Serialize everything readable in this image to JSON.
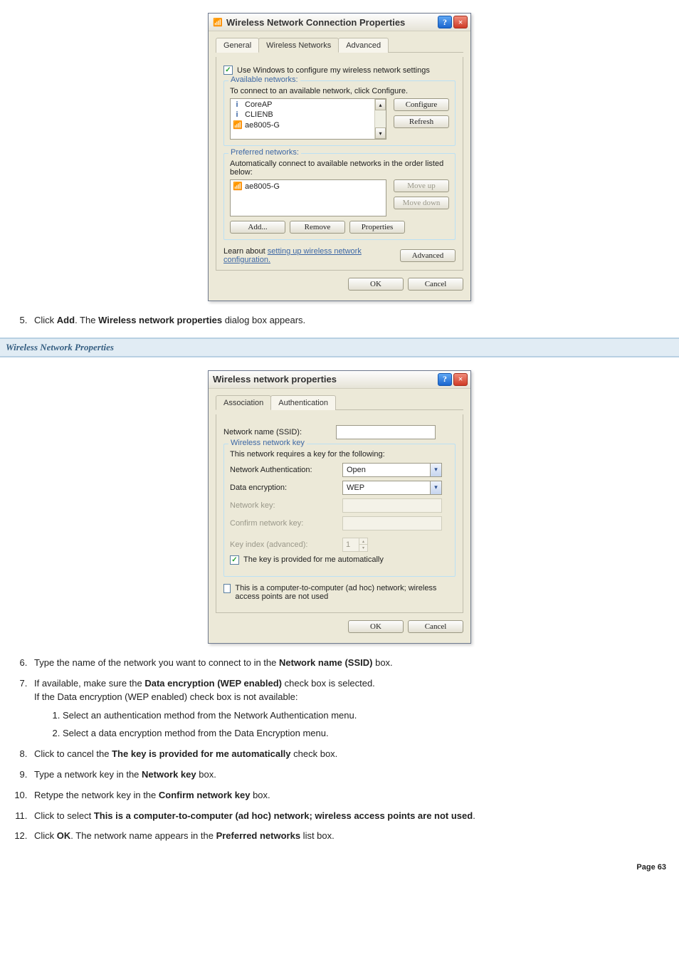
{
  "dialog1": {
    "title": "Wireless Network Connection Properties",
    "tabs": [
      "General",
      "Wireless Networks",
      "Advanced"
    ],
    "use_windows": "Use Windows to configure my wireless network settings",
    "available": {
      "legend": "Available networks:",
      "hint": "To connect to an available network, click Configure.",
      "items": [
        {
          "icon": "i",
          "name": "CoreAP"
        },
        {
          "icon": "i",
          "name": "CLIENB"
        },
        {
          "icon": "q",
          "name": "ae8005-G"
        }
      ],
      "configure": "Configure",
      "refresh": "Refresh"
    },
    "preferred": {
      "legend": "Preferred networks:",
      "hint": "Automatically connect to available networks in the order listed below:",
      "items": [
        {
          "icon": "q",
          "name": "ae8005-G"
        }
      ],
      "moveup": "Move up",
      "movedown": "Move down",
      "add": "Add...",
      "remove": "Remove",
      "properties": "Properties"
    },
    "learn_prefix": "Learn about ",
    "learn_link": "setting up wireless network configuration.",
    "advanced": "Advanced",
    "ok": "OK",
    "cancel": "Cancel"
  },
  "step5_pre": "Click ",
  "step5_bold1": "Add",
  "step5_mid": ". The ",
  "step5_bold2": "Wireless network properties",
  "step5_post": " dialog box appears.",
  "banner": "Wireless Network Properties",
  "dialog2": {
    "title": "Wireless network properties",
    "tabs": [
      "Association",
      "Authentication"
    ],
    "ssid_label": "Network name (SSID):",
    "key": {
      "legend": "Wireless network key",
      "hint": "This network requires a key for the following:",
      "auth_label": "Network Authentication:",
      "auth_value": "Open",
      "enc_label": "Data encryption:",
      "enc_value": "WEP",
      "netkey_label": "Network key:",
      "confirm_label": "Confirm network key:",
      "idx_label": "Key index (advanced):",
      "idx_value": "1",
      "auto": "The key is provided for me automatically"
    },
    "adhoc": "This is a computer-to-computer (ad hoc) network; wireless access points are not used",
    "ok": "OK",
    "cancel": "Cancel"
  },
  "steps": {
    "s6_pre": "Type the name of the network you want to connect to in the ",
    "s6_bold": "Network name (SSID)",
    "s6_post": " box.",
    "s7_a_pre": "If available, make sure the ",
    "s7_a_bold": "Data encryption (WEP enabled)",
    "s7_a_post": " check box is selected.",
    "s7_b": "If the Data encryption (WEP enabled) check box is not available:",
    "s7_1": "Select an authentication method from the Network Authentication menu.",
    "s7_2": "Select a data encryption method from the Data Encryption menu.",
    "s8_pre": "Click to cancel the ",
    "s8_bold": "The key is provided for me automatically",
    "s8_post": " check box.",
    "s9_pre": "Type a network key in the ",
    "s9_bold": "Network key",
    "s9_post": " box.",
    "s10_pre": "Retype the network key in the ",
    "s10_bold": "Confirm network key",
    "s10_post": " box.",
    "s11_pre": "Click to select ",
    "s11_bold": "This is a computer-to-computer (ad hoc) network; wireless access points are not used",
    "s11_post": ".",
    "s12_pre": "Click ",
    "s12_bold1": "OK",
    "s12_mid": ". The network name appears in the ",
    "s12_bold2": "Preferred networks",
    "s12_post": " list box."
  },
  "page_label": "Page 63"
}
